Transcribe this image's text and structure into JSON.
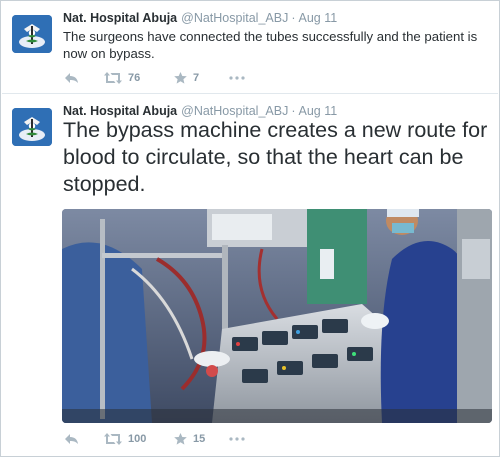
{
  "colors": {
    "text": "#292f33",
    "muted": "#8899a6",
    "icon": "#aab8c2",
    "divider": "#e1e8ed"
  },
  "tweets": [
    {
      "name": "Nat. Hospital Abuja",
      "handle": "@NatHospital_ABJ",
      "separator": "·",
      "time": "Aug 11",
      "text": "The surgeons have connected the tubes successfully and the patient is now on bypass.",
      "retweets": "76",
      "favorites": "7",
      "icons": [
        "reply-icon",
        "retweet-icon",
        "favorite-icon",
        "more-icon"
      ]
    },
    {
      "name": "Nat. Hospital Abuja",
      "handle": "@NatHospital_ABJ",
      "separator": "·",
      "time": "Aug 11",
      "text": "The bypass machine creates a new route for blood to circulate, so that the heart can be stopped.",
      "retweets": "100",
      "favorites": "15",
      "icons": [
        "reply-icon",
        "retweet-icon",
        "favorite-icon",
        "more-icon"
      ]
    }
  ]
}
